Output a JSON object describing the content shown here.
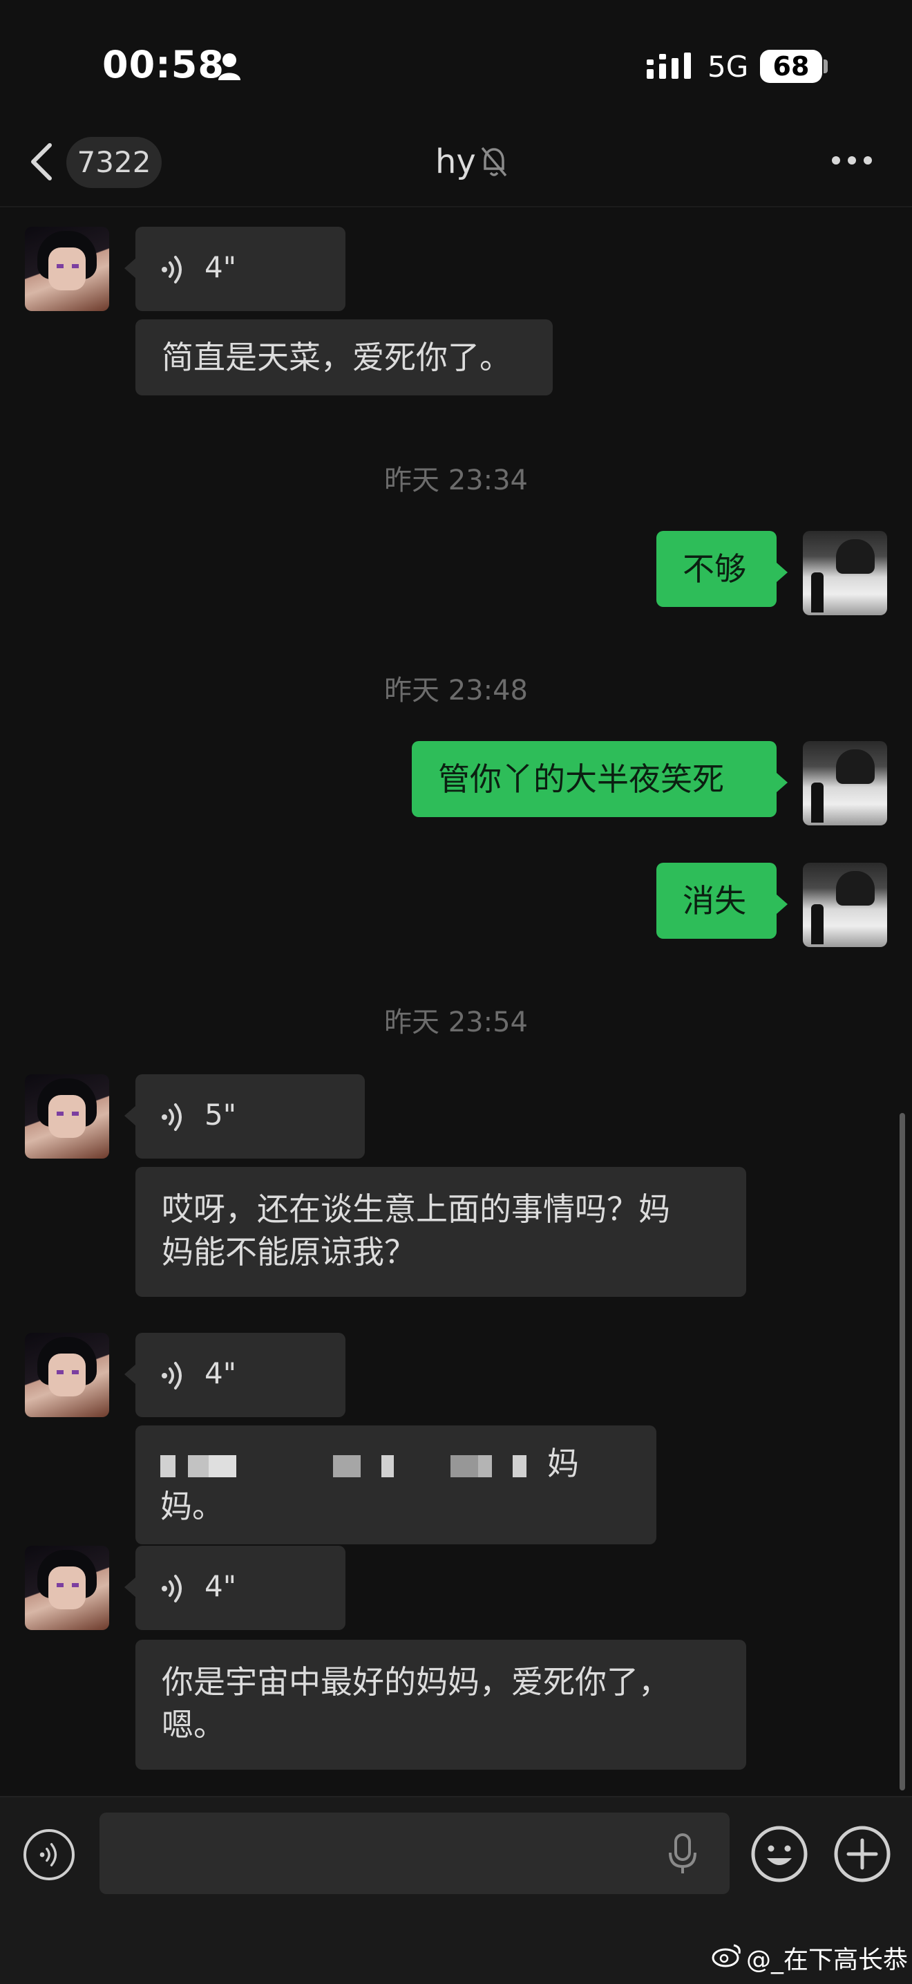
{
  "status_bar": {
    "time": "00:58",
    "network": "5G",
    "battery": "68"
  },
  "header": {
    "back_badge": "7322",
    "title": "hy"
  },
  "messages": [
    {
      "side": "in",
      "type": "voice",
      "duration": "4\""
    },
    {
      "side": "in",
      "type": "text",
      "text": "简直是天菜，爱死你了。"
    },
    {
      "type": "timestamp",
      "text": "昨天 23:34"
    },
    {
      "side": "out",
      "type": "text",
      "text": "不够"
    },
    {
      "type": "timestamp",
      "text": "昨天 23:48"
    },
    {
      "side": "out",
      "type": "text",
      "text": "管你丫的大半夜笑死"
    },
    {
      "side": "out",
      "type": "text",
      "text": "消失"
    },
    {
      "type": "timestamp",
      "text": "昨天 23:54"
    },
    {
      "side": "in",
      "type": "voice",
      "duration": "5\""
    },
    {
      "side": "in",
      "type": "text",
      "text_line1": "哎呀，还在谈生意上面的事情吗？妈",
      "text_line2": "妈能不能原谅我？"
    },
    {
      "side": "in",
      "type": "voice",
      "duration": "4\""
    },
    {
      "side": "in",
      "type": "text_redacted",
      "text": "妈妈。"
    },
    {
      "side": "in",
      "type": "voice",
      "duration": "4\""
    },
    {
      "side": "in",
      "type": "text",
      "text_line1": "你是宇宙中最好的妈妈，爱死你了，",
      "text_line2": "嗯。"
    }
  ],
  "input": {
    "value": "",
    "placeholder": ""
  },
  "watermark": "@_在下高长恭",
  "colors": {
    "background": "#111111",
    "bubble_in": "#2c2c2c",
    "bubble_out": "#2ebd59",
    "timestamp": "#6c6c6c"
  },
  "icons": [
    "person-icon",
    "signal-icon",
    "back-chevron-icon",
    "mute-bell-icon",
    "more-icon",
    "voice-wave-icon",
    "microphone-icon",
    "emoji-icon",
    "plus-icon",
    "weibo-icon"
  ]
}
